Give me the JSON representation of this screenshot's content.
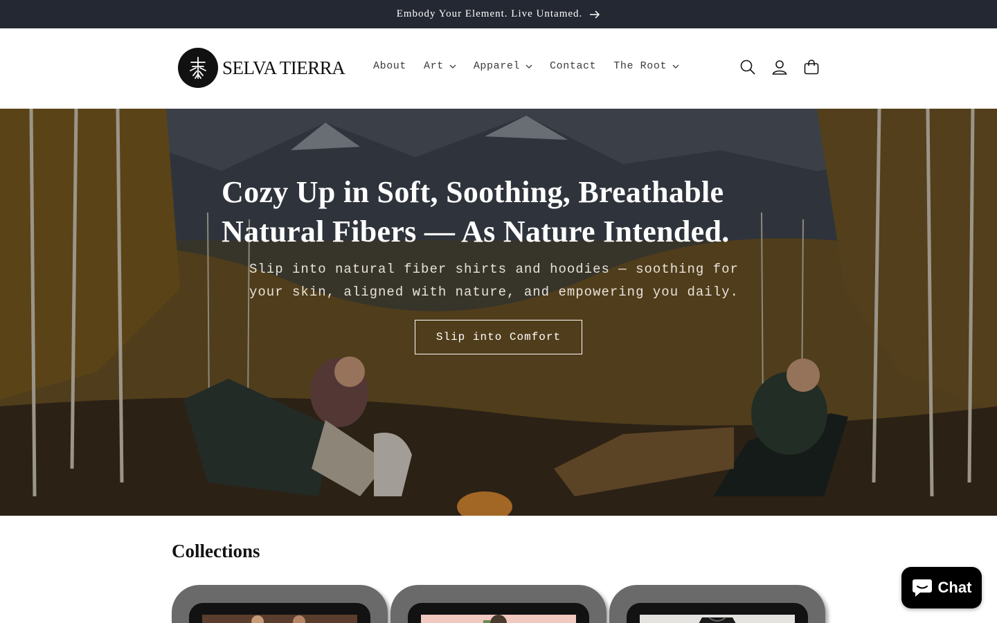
{
  "announcement": {
    "text": "Embody Your Element. Live Untamed."
  },
  "brand": {
    "name": "SELVA TIERRA"
  },
  "nav": {
    "items": [
      {
        "label": "About",
        "has_dropdown": false
      },
      {
        "label": "Art",
        "has_dropdown": true
      },
      {
        "label": "Apparel",
        "has_dropdown": true
      },
      {
        "label": "Contact",
        "has_dropdown": false
      },
      {
        "label": "The Root",
        "has_dropdown": true
      }
    ]
  },
  "header_icons": [
    "search-icon",
    "account-icon",
    "cart-icon"
  ],
  "hero": {
    "title": "Cozy Up in Soft, Soothing, Breathable Natural Fibers — As Nature Intended.",
    "subtitle": "Slip into natural fiber shirts and hoodies — soothing for your skin, aligned with nature, and empowering you daily.",
    "button_label": "Slip into Comfort"
  },
  "collections": {
    "title": "Collections"
  },
  "chat": {
    "label": "Chat"
  },
  "colors": {
    "announcement_bg": "#242833",
    "text": "#121212",
    "chat_bg": "#000000"
  }
}
